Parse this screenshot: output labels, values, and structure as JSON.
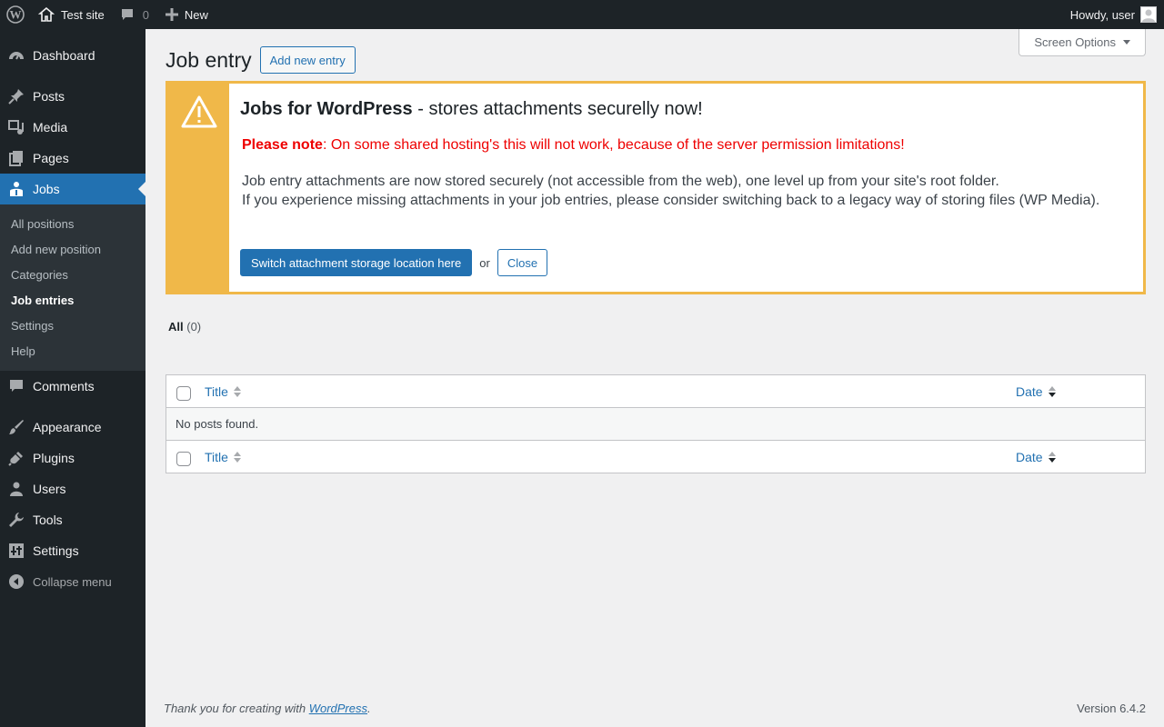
{
  "adminbar": {
    "site_name": "Test site",
    "comments_count": "0",
    "new_label": "New",
    "howdy": "Howdy, user"
  },
  "sidebar": {
    "items_top": [
      {
        "label": "Dashboard",
        "icon": "dashboard-icon"
      }
    ],
    "items_mid": [
      {
        "label": "Posts",
        "icon": "pin-icon"
      },
      {
        "label": "Media",
        "icon": "media-icon"
      },
      {
        "label": "Pages",
        "icon": "pages-icon"
      },
      {
        "label": "Jobs",
        "icon": "jobs-icon"
      }
    ],
    "submenu": [
      {
        "label": "All positions"
      },
      {
        "label": "Add new position"
      },
      {
        "label": "Categories"
      },
      {
        "label": "Job entries"
      },
      {
        "label": "Settings"
      },
      {
        "label": "Help"
      }
    ],
    "comments": "Comments",
    "items_bottom": [
      {
        "label": "Appearance"
      },
      {
        "label": "Plugins"
      },
      {
        "label": "Users"
      },
      {
        "label": "Tools"
      },
      {
        "label": "Settings"
      }
    ],
    "collapse": "Collapse menu"
  },
  "main": {
    "screen_options": "Screen Options",
    "title": "Job entry",
    "add_new": "Add new entry",
    "notice": {
      "heading_bold": "Jobs for WordPress",
      "heading_rest": " - stores attachments securelly now!",
      "warn_bold": "Please note",
      "warn_rest": ": On some shared hosting's this will not work, because of the server permission limitations!",
      "info_line1": "Job entry attachments are now stored securely (not accessible from the web), one level up from your site's root folder.",
      "info_line2": "If you experience missing attachments in your job entries, please consider switching back to a legacy way of storing files (WP Media).",
      "switch_button": "Switch attachment storage location here",
      "or": "or",
      "close_button": "Close"
    },
    "filter": {
      "all_label": "All",
      "all_count": "(0)"
    },
    "table": {
      "col_title": "Title",
      "col_date": "Date",
      "empty": "No posts found."
    }
  },
  "footer": {
    "thanks_prefix": "Thank you for creating with ",
    "thanks_link": "WordPress",
    "thanks_suffix": ".",
    "version": "Version 6.4.2"
  }
}
